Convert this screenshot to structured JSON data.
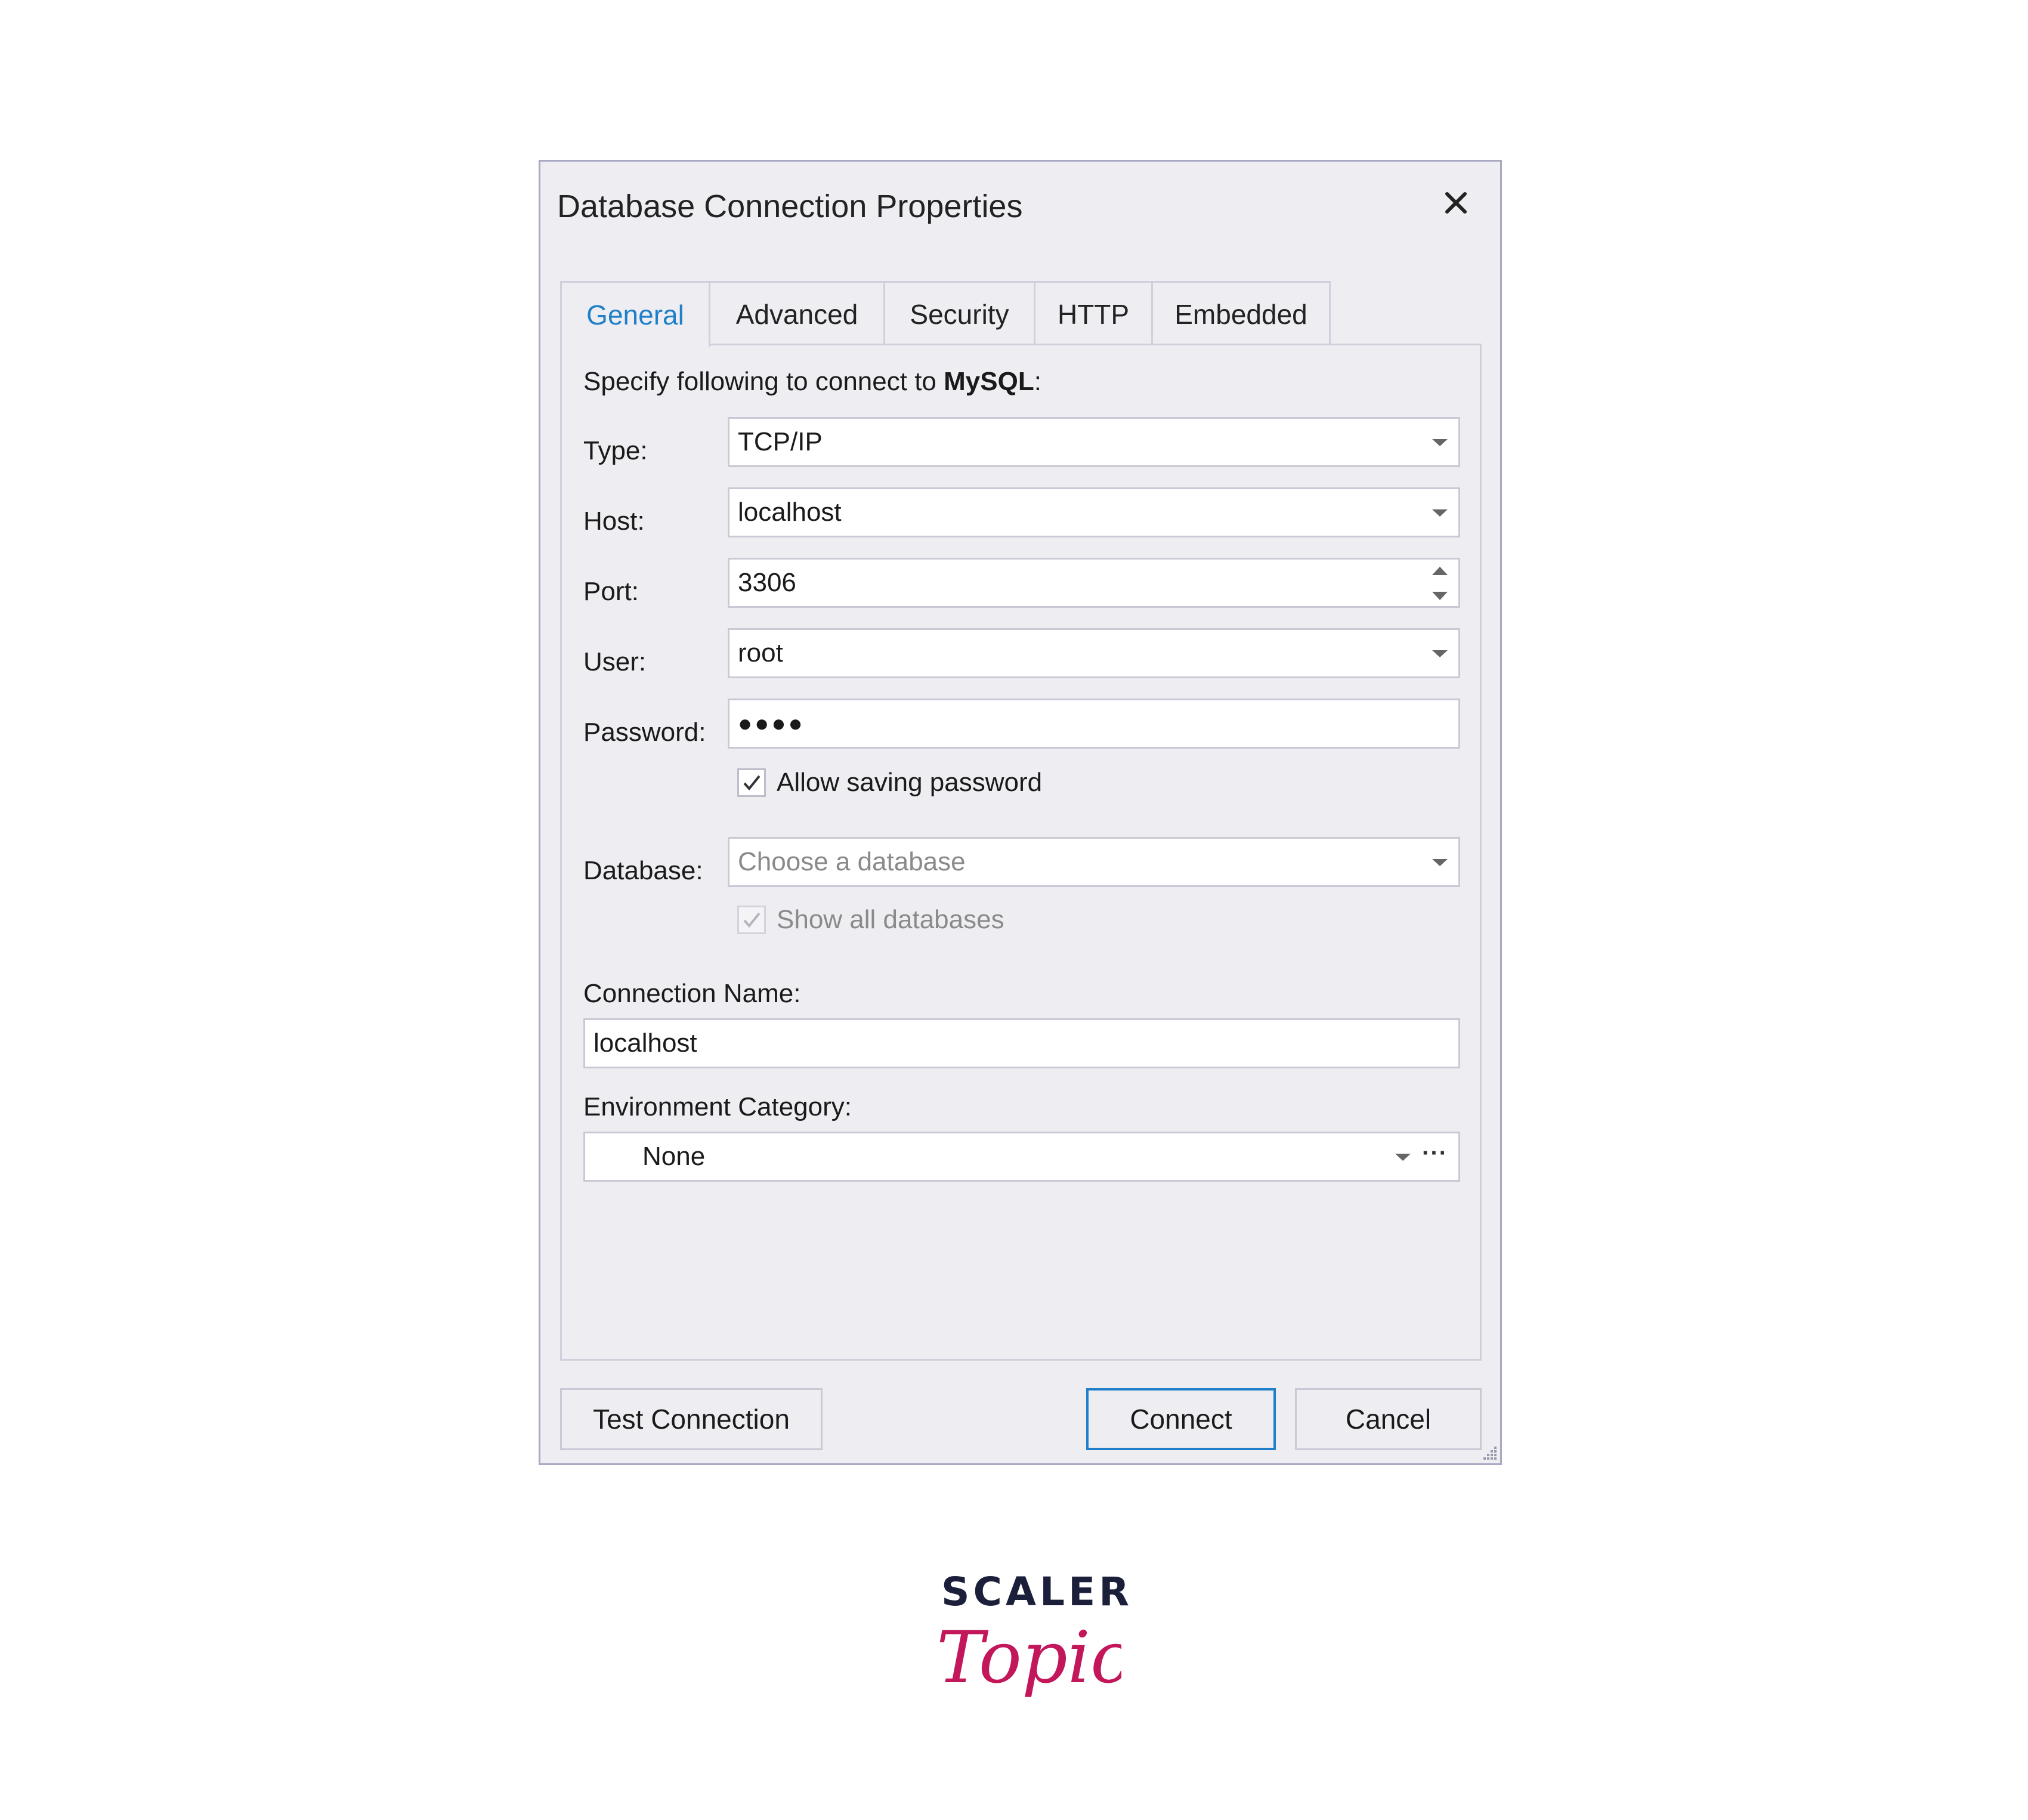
{
  "dialog": {
    "title": "Database Connection Properties",
    "close_icon": "close-icon"
  },
  "tabs": [
    {
      "label": "General",
      "active": true
    },
    {
      "label": "Advanced",
      "active": false
    },
    {
      "label": "Security",
      "active": false
    },
    {
      "label": "HTTP",
      "active": false
    },
    {
      "label": "Embedded",
      "active": false
    }
  ],
  "general": {
    "intro_prefix": "Specify following to connect to ",
    "intro_bold": "MySQL",
    "intro_suffix": ":",
    "type_label": "Type:",
    "type_value": "TCP/IP",
    "host_label": "Host:",
    "host_value": "localhost",
    "port_label": "Port:",
    "port_value": "3306",
    "user_label": "User:",
    "user_value": "root",
    "password_label": "Password:",
    "password_mask": "●●●●",
    "allow_saving_label": "Allow saving password",
    "allow_saving_checked": true,
    "database_label": "Database:",
    "database_placeholder": "Choose a database",
    "show_all_label": "Show all databases",
    "show_all_checked": true,
    "show_all_disabled": true,
    "connection_name_label": "Connection Name:",
    "connection_name_value": "localhost",
    "environment_label": "Environment Category:",
    "environment_value": "None",
    "environment_more": "···"
  },
  "buttons": {
    "test": "Test Connection",
    "connect": "Connect",
    "cancel": "Cancel"
  },
  "colors": {
    "accent": "#1f7fc8",
    "dialog_bg": "#eeeef2",
    "logo_dark": "#1b1f3a",
    "logo_pink": "#c2185b"
  },
  "logo": {
    "top": "SCALER",
    "bottom": "Topics"
  }
}
